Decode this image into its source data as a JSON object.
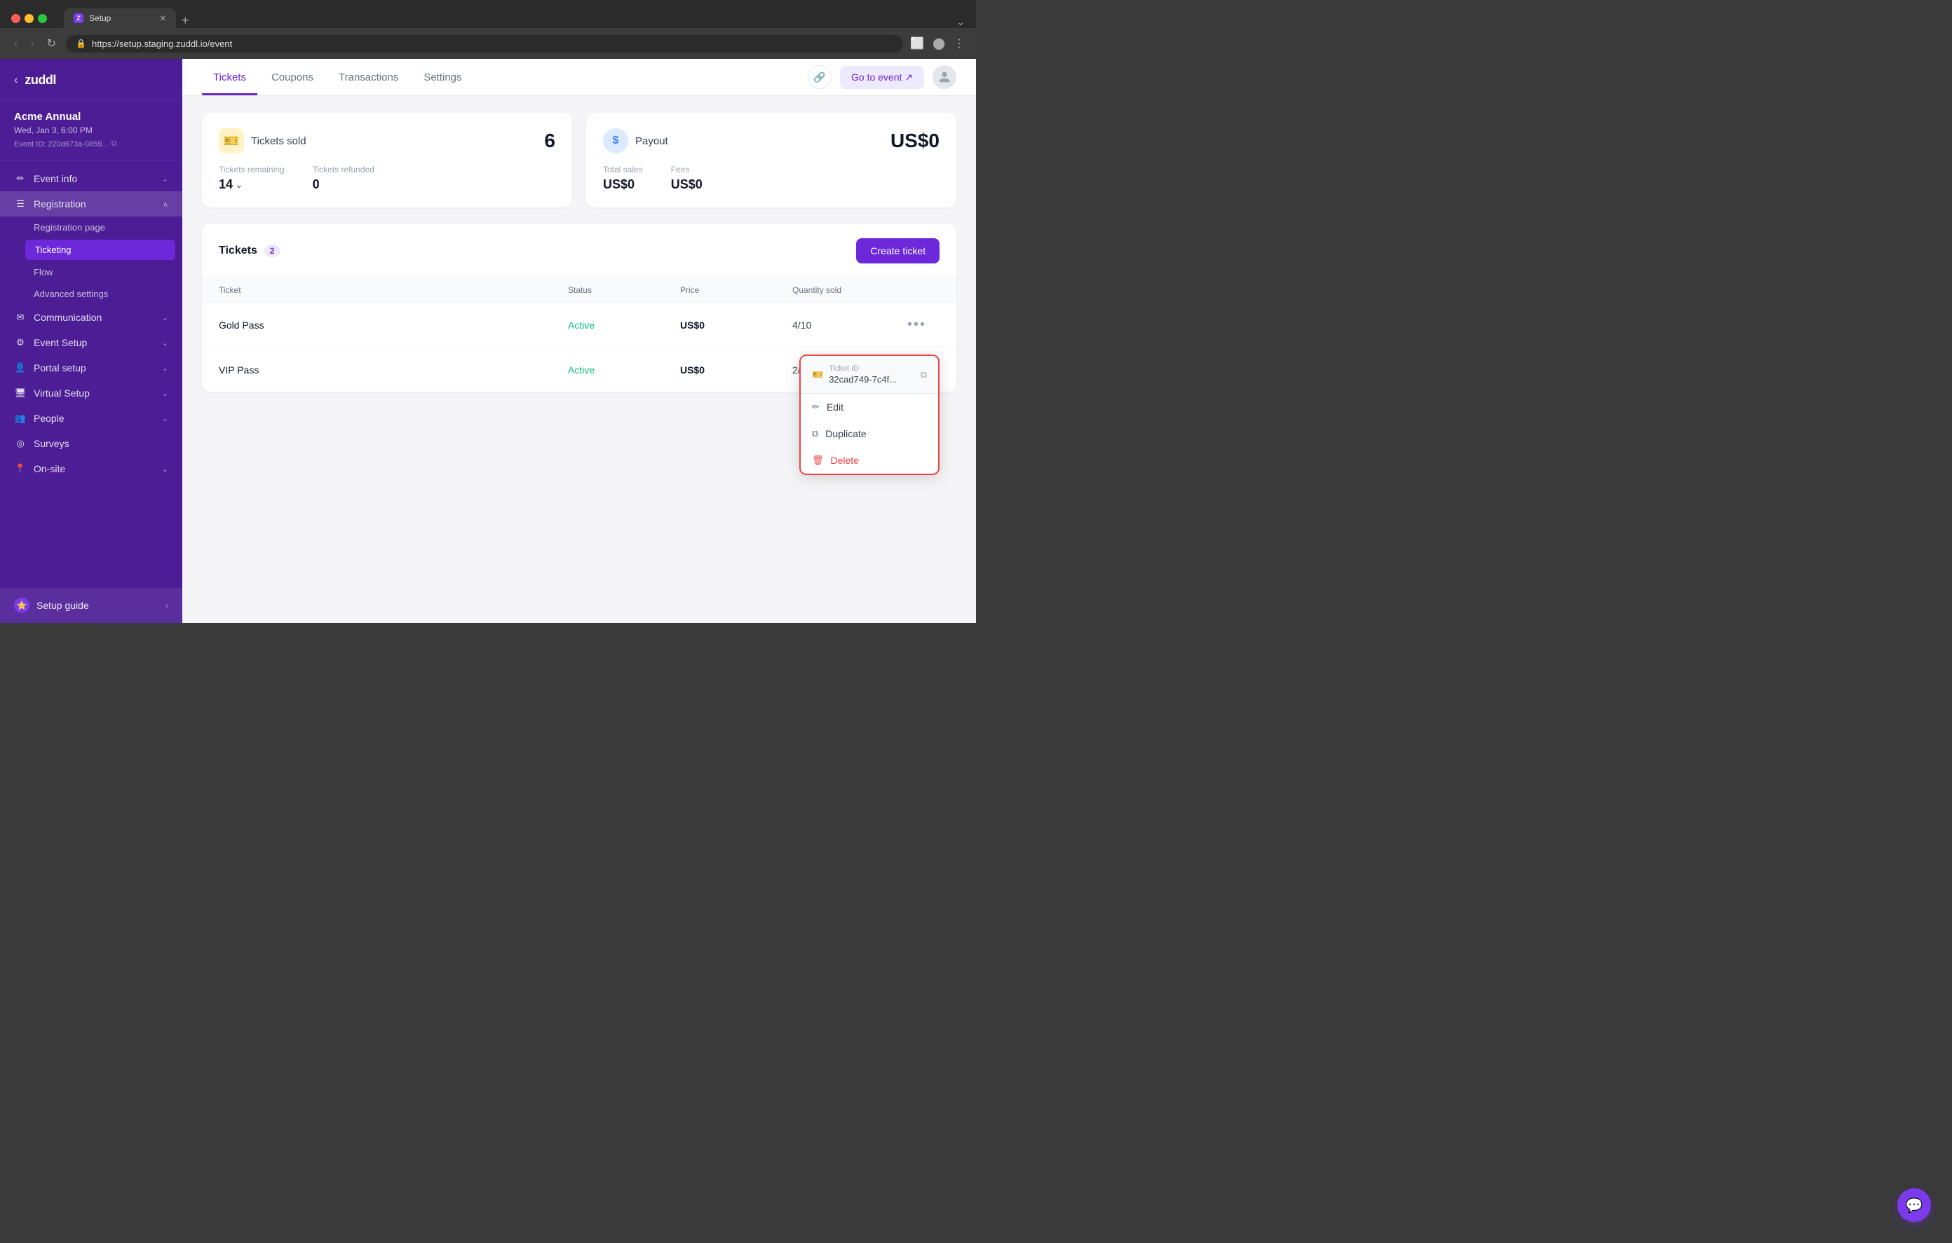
{
  "browser": {
    "url": "https://setup.staging.zuddl.io/event",
    "tab_title": "Setup",
    "tab_favicon": "Z"
  },
  "header": {
    "tabs": [
      {
        "label": "Tickets",
        "active": true
      },
      {
        "label": "Coupons",
        "active": false
      },
      {
        "label": "Transactions",
        "active": false
      },
      {
        "label": "Settings",
        "active": false
      }
    ],
    "go_to_event_label": "Go to event ↗",
    "link_icon": "🔗"
  },
  "sidebar": {
    "logo": "zuddl",
    "back_label": "‹",
    "event": {
      "name": "Acme Annual",
      "date": "Wed, Jan 3, 6:00 PM",
      "id_label": "Event ID: 220d673a-0859...",
      "copy_icon": "⧉"
    },
    "nav_items": [
      {
        "label": "Event info",
        "icon": "✏",
        "has_chevron": true,
        "active": false
      },
      {
        "label": "Registration",
        "icon": "☰",
        "has_chevron": true,
        "active": true,
        "expanded": true
      },
      {
        "label": "Registration page",
        "sub": true,
        "active": false
      },
      {
        "label": "Ticketing",
        "sub": true,
        "active": true
      },
      {
        "label": "Flow",
        "sub": true,
        "active": false
      },
      {
        "label": "Advanced settings",
        "sub": true,
        "active": false
      },
      {
        "label": "Communication",
        "icon": "✉",
        "has_chevron": true,
        "active": false
      },
      {
        "label": "Event Setup",
        "icon": "⚙",
        "has_chevron": true,
        "active": false
      },
      {
        "label": "Portal setup",
        "icon": "👤",
        "has_chevron": true,
        "active": false
      },
      {
        "label": "Virtual Setup",
        "icon": "🖥",
        "has_chevron": true,
        "active": false
      },
      {
        "label": "People",
        "icon": "👥",
        "has_chevron": true,
        "active": false
      },
      {
        "label": "Surveys",
        "icon": "◎",
        "has_chevron": false,
        "active": false
      },
      {
        "label": "On-site",
        "icon": "📍",
        "has_chevron": true,
        "active": false
      }
    ],
    "setup_guide": {
      "label": "Setup guide",
      "chevron": "›"
    }
  },
  "stats": {
    "tickets_sold": {
      "title": "Tickets sold",
      "icon": "🎫",
      "value": "6",
      "remaining_label": "Tickets remaining",
      "remaining_value": "14",
      "refunded_label": "Tickets refunded",
      "refunded_value": "0"
    },
    "payout": {
      "title": "Payout",
      "icon": "$",
      "value": "US$0",
      "total_sales_label": "Total sales",
      "total_sales_value": "US$0",
      "fees_label": "Fees",
      "fees_value": "US$0"
    }
  },
  "tickets_section": {
    "title": "Tickets",
    "badge": "2",
    "create_btn": "Create ticket",
    "columns": [
      "Ticket",
      "Status",
      "Price",
      "Quantity sold",
      ""
    ],
    "rows": [
      {
        "name": "Gold Pass",
        "status": "Active",
        "price": "US$0",
        "quantity": "4/10"
      },
      {
        "name": "VIP Pass",
        "status": "Active",
        "price": "US$0",
        "quantity": "2/10"
      }
    ]
  },
  "dropdown": {
    "ticket_id_label": "Ticket ID",
    "ticket_id_value": "32cad749-7c4f...",
    "copy_icon": "⧉",
    "items": [
      {
        "label": "Edit",
        "icon": "✏"
      },
      {
        "label": "Duplicate",
        "icon": "⧉"
      },
      {
        "label": "Delete",
        "icon": "🗑",
        "danger": true
      }
    ]
  },
  "chat_fab_icon": "💬"
}
